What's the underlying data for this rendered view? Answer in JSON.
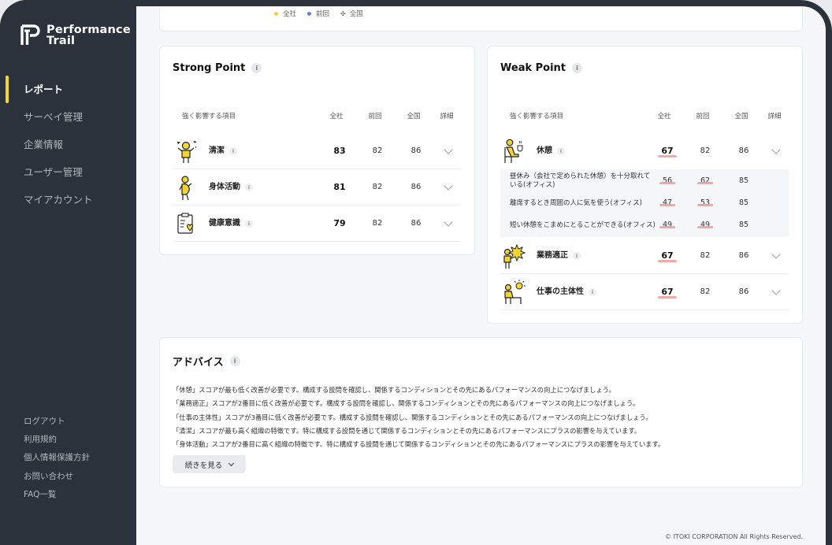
{
  "brand": {
    "name_line1": "Performance",
    "name_line2": "Trail"
  },
  "nav": [
    {
      "label": "レポート",
      "active": true
    },
    {
      "label": "サーベイ管理"
    },
    {
      "label": "企業情報"
    },
    {
      "label": "ユーザー管理"
    },
    {
      "label": "マイアカウント"
    }
  ],
  "footer_nav": [
    "ログアウト",
    "利用規約",
    "個人情報保護方針",
    "お問い合わせ",
    "FAQ一覧"
  ],
  "legend": [
    {
      "label": "全社",
      "color": "#f2d531"
    },
    {
      "label": "前回",
      "color": "#6e84c8"
    },
    {
      "label": "全国",
      "color": "#666666",
      "symbol": "✣"
    }
  ],
  "strong": {
    "title": "Strong Point",
    "headers": {
      "item": "強く影響する項目",
      "company": "全社",
      "prev": "前回",
      "national": "全国",
      "detail": "詳細"
    },
    "rows": [
      {
        "icon": "cleanliness-icon",
        "label": "清潔",
        "company": "83",
        "prev": "82",
        "national": "86"
      },
      {
        "icon": "exercise-icon",
        "label": "身体活動",
        "company": "81",
        "prev": "82",
        "national": "86"
      },
      {
        "icon": "health-awareness-icon",
        "label": "健康意識",
        "company": "79",
        "prev": "82",
        "national": "86"
      }
    ]
  },
  "weak": {
    "title": "Weak Point",
    "headers": {
      "item": "強く影響する項目",
      "company": "全社",
      "prev": "前回",
      "national": "全国",
      "detail": "詳細"
    },
    "rows": [
      {
        "icon": "rest-icon",
        "label": "休憩",
        "company": "67",
        "prev": "82",
        "national": "86"
      },
      {
        "icon": "work-fit-icon",
        "label": "業務適正",
        "company": "67",
        "prev": "82",
        "national": "86"
      },
      {
        "icon": "initiative-icon",
        "label": "仕事の主体性",
        "company": "67",
        "prev": "82",
        "national": "86"
      }
    ],
    "sub_rows": [
      {
        "label": "昼休み（会社で定められた休憩）を十分取れている(オフィス)",
        "company": "56",
        "prev": "62",
        "national": "85"
      },
      {
        "label": "離席するとき周囲の人に気を使う(オフィス)",
        "company": "47",
        "prev": "53",
        "national": "85"
      },
      {
        "label": "短い休憩をこまめにとることができる(オフィス)",
        "company": "49",
        "prev": "49",
        "national": "85"
      }
    ]
  },
  "advice": {
    "title": "アドバイス",
    "lines": [
      "「休憩」スコアが最も低く改善が必要です。構成する設問を確認し、関係するコンディションとその先にあるパフォーマンスの向上につなげましょう。",
      "「業務適正」スコアが2番目に低く改善が必要です。構成する設問を確認し、関係するコンディションとその先にあるパフォーマンスの向上につなげましょう。",
      "「仕事の主体性」スコアが3番目に低く改善が必要です。構成する設問を確認し、関係するコンディションとその先にあるパフォーマンスの向上につなげましょう。",
      "「清潔」スコアが最も高く組織の特徴です。特に構成する設問を通じて関係するコンディションとその先にあるパフォーマンスにプラスの影響を与えています。",
      "「身体活動」スコアが2番目に高く組織の特徴です。特に構成する設問を通じて関係するコンディションとその先にあるパフォーマンスにプラスの影響を与えています。"
    ],
    "more_label": "続きを見る"
  },
  "copyright": "© ITOKI CORPORATION All Rights Reserved."
}
